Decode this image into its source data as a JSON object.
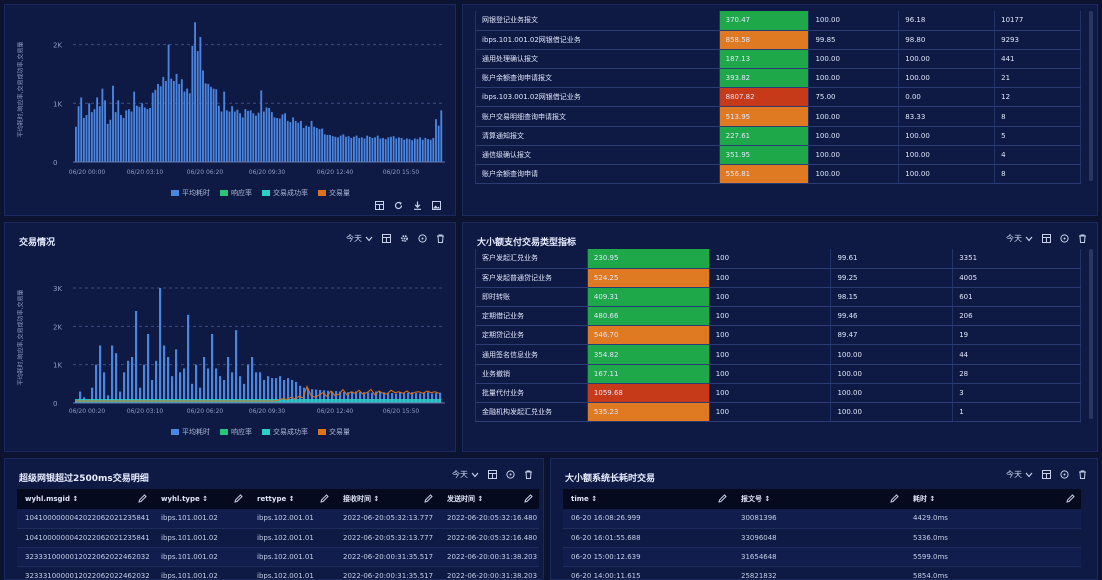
{
  "panel1": {
    "ylabel": "平均耗时,响应率,交易成功率,交易量",
    "legend": [
      "平均耗时",
      "响应率",
      "交易成功率",
      "交易量"
    ],
    "colors": {
      "avg": "#4a85e0",
      "resp": "#27c47a",
      "succ": "#2ad0c8",
      "vol": "#d9731c"
    },
    "icons": [
      "table-view-icon",
      "refresh-icon",
      "download-icon",
      "image-icon"
    ],
    "chart_data": {
      "type": "bar",
      "yticks": [
        "2K",
        "1K",
        "0"
      ],
      "ylim": [
        0,
        2300
      ],
      "xticks": [
        "06/20 00:00",
        "06/20 03:10",
        "06/20 06:20",
        "06/20 09:30",
        "06/20 12:40",
        "06/20 15:50"
      ],
      "series": [
        {
          "name": "平均耗时",
          "values": [
            600,
            950,
            1100,
            750,
            800,
            1000,
            850,
            900,
            1100,
            950,
            1250,
            1050,
            650,
            720,
            1300,
            850,
            1050,
            800,
            750,
            880,
            900,
            860,
            1200,
            960,
            940,
            1000,
            930,
            900,
            920,
            1180,
            1230,
            1330,
            1290,
            1450,
            1380,
            2000,
            1420,
            1380,
            1500,
            1330,
            1410,
            1200,
            1250,
            1170,
            1980,
            2380,
            1890,
            2130,
            1560,
            1340,
            1330,
            1280,
            1250,
            1240,
            960,
            860,
            1200,
            880,
            860,
            950,
            860,
            890,
            830,
            760,
            900,
            870,
            880,
            830,
            790,
            840,
            1220,
            860,
            930,
            920,
            850,
            760,
            750,
            740,
            810,
            830,
            700,
            680,
            760,
            700,
            670,
            700,
            580,
            620,
            600,
            700,
            600,
            580,
            560,
            570,
            470,
            460,
            460,
            440,
            430,
            420,
            450,
            470,
            430,
            440,
            410,
            430,
            450,
            410,
            420,
            400,
            450,
            430,
            410,
            420,
            450,
            400,
            410,
            390,
            420,
            430,
            440,
            400,
            420,
            410,
            380,
            400,
            390,
            370,
            400,
            390,
            420,
            380,
            410,
            390,
            380,
            410,
            730,
            620,
            880
          ]
        }
      ]
    }
  },
  "panel2": {
    "rows": [
      [
        "网银登记业务报文",
        "370.47",
        "100.00",
        "96.18",
        "10177",
        "g"
      ],
      [
        "ibps.101.001.02网银借记业务",
        "858.58",
        "99.85",
        "98.80",
        "9293",
        "o"
      ],
      [
        "通用处理确认报文",
        "187.13",
        "100.00",
        "100.00",
        "441",
        "g"
      ],
      [
        "账户余额查询申请报文",
        "393.82",
        "100.00",
        "100.00",
        "21",
        "g"
      ],
      [
        "ibps.103.001.02网银借记业务",
        "8807.82",
        "75.00",
        "0.00",
        "12",
        "r"
      ],
      [
        "账户交易明细查询申请报文",
        "513.95",
        "100.00",
        "83.33",
        "8",
        "o"
      ],
      [
        "清算通知报文",
        "227.61",
        "100.00",
        "100.00",
        "5",
        "g"
      ],
      [
        "通信级确认报文",
        "351.95",
        "100.00",
        "100.00",
        "4",
        "g"
      ],
      [
        "账户余额查询申请",
        "556.81",
        "100.00",
        "100.00",
        "8",
        "o"
      ]
    ]
  },
  "panel3": {
    "title": "交易情况",
    "select": "今天",
    "ylabel": "平均耗时,响应率,交易成功率,交易量",
    "legend": [
      "平均耗时",
      "响应率",
      "交易成功率",
      "交易量"
    ],
    "chart_data": {
      "type": "bar",
      "yticks": [
        "3K",
        "2K",
        "1K",
        "0"
      ],
      "ylim": [
        0,
        3600
      ],
      "xticks": [
        "06/20 00:20",
        "06/20 03:10",
        "06/20 06:20",
        "06/20 09:30",
        "06/20 12:40",
        "06/20 15:50"
      ],
      "series": [
        {
          "name": "平均耗时",
          "values": [
            50,
            300,
            150,
            50,
            400,
            1000,
            1500,
            800,
            200,
            1500,
            1300,
            300,
            800,
            1100,
            1200,
            2400,
            400,
            1000,
            1800,
            600,
            1100,
            3000,
            1500,
            1200,
            700,
            1400,
            800,
            900,
            2300,
            500,
            1000,
            400,
            1200,
            900,
            1800,
            900,
            700,
            600,
            1200,
            800,
            1900,
            700,
            500,
            1000,
            1200,
            800,
            800,
            600,
            700,
            650,
            650,
            700,
            600,
            650,
            600,
            550,
            450,
            400,
            380,
            360,
            350,
            340,
            330,
            320,
            300,
            310,
            300,
            290,
            280,
            300,
            300,
            290,
            280,
            280,
            270,
            300,
            290,
            280,
            270,
            260,
            250,
            280,
            260,
            270,
            280,
            260,
            250,
            270,
            280,
            250,
            260,
            270
          ]
        },
        {
          "name": "交易量",
          "values": [
            0,
            0,
            0,
            0,
            0,
            0,
            0,
            0,
            0,
            0,
            0,
            0,
            0,
            0,
            0,
            0,
            0,
            0,
            0,
            0,
            0,
            0,
            0,
            0,
            0,
            0,
            0,
            0,
            0,
            0,
            0,
            0,
            0,
            0,
            0,
            0,
            0,
            0,
            0,
            0,
            0,
            0,
            0,
            0,
            0,
            0,
            0,
            0,
            0,
            0,
            0,
            30,
            60,
            40,
            100,
            60,
            120,
            80,
            380,
            140,
            100,
            160,
            220,
            120,
            260,
            140,
            180,
            300,
            160,
            240,
            200,
            280,
            180,
            220,
            300,
            160,
            260,
            200,
            180,
            280,
            220,
            240,
            200,
            260,
            180,
            230,
            240,
            200,
            260,
            220,
            240,
            200
          ]
        }
      ]
    }
  },
  "panel4": {
    "title": "大小额支付交易类型指标",
    "select": "今天",
    "rows": [
      [
        "客户发起汇兑业务",
        "230.95",
        "100",
        "99.61",
        "3351",
        "g"
      ],
      [
        "客户发起普通贷记业务",
        "524.25",
        "100",
        "99.25",
        "4005",
        "o"
      ],
      [
        "即时转账",
        "409.31",
        "100",
        "98.15",
        "601",
        "g"
      ],
      [
        "定期借记业务",
        "480.66",
        "100",
        "99.46",
        "206",
        "g"
      ],
      [
        "定期贷记业务",
        "546.70",
        "100",
        "89.47",
        "19",
        "o"
      ],
      [
        "通用签名信息业务",
        "354.82",
        "100",
        "100.00",
        "44",
        "g"
      ],
      [
        "业务撤销",
        "167.11",
        "100",
        "100.00",
        "28",
        "g"
      ],
      [
        "批量代付业务",
        "1059.68",
        "100",
        "100.00",
        "3",
        "r"
      ],
      [
        "金融机构发起汇兑业务",
        "535.23",
        "100",
        "100.00",
        "1",
        "o"
      ]
    ]
  },
  "panel5": {
    "title": "超级网银超过2500ms交易明细",
    "select": "今天",
    "headers": [
      "wyhl.msgid",
      "wyhl.type",
      "rettype",
      "接收时间",
      "发送时间"
    ],
    "rows": [
      [
        "1041000000042022062021235841",
        "ibps.101.001.02",
        "ibps.102.001.01",
        "2022-06-20:05:32:13.777",
        "2022-06-20:05:32:16.480"
      ],
      [
        "1041000000042022062021235841",
        "ibps.101.001.02",
        "ibps.102.001.01",
        "2022-06-20:05:32:13.777",
        "2022-06-20:05:32:16.480"
      ],
      [
        "3233310000012022062022462032",
        "ibps.101.001.02",
        "ibps.102.001.01",
        "2022-06-20:00:31:35.517",
        "2022-06-20:00:31:38.203"
      ],
      [
        "3233310000012022062022462032",
        "ibps.101.001.02",
        "ibps.102.001.01",
        "2022-06-20:00:31:35.517",
        "2022-06-20:00:31:38.203"
      ]
    ]
  },
  "panel6": {
    "title": "大小额系统长耗时交易",
    "select": "今天",
    "headers": [
      "time",
      "报文号",
      "耗时"
    ],
    "rows": [
      [
        "06-20 16:08:26.999",
        "30081396",
        "4429.0ms"
      ],
      [
        "06-20 16:01:55.688",
        "33096048",
        "5336.0ms"
      ],
      [
        "06-20 15:00:12.639",
        "31654648",
        "5599.0ms"
      ],
      [
        "06-20 14:00:11.615",
        "25821832",
        "5854.0ms"
      ]
    ]
  }
}
